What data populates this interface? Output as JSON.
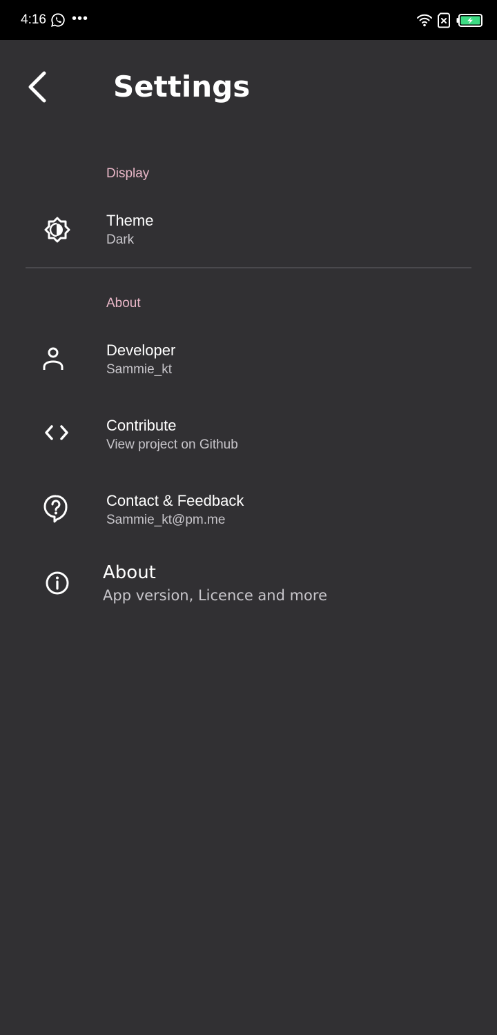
{
  "status_bar": {
    "time": "4:16",
    "overflow_dots": "•••",
    "icons": [
      "whatsapp-icon",
      "wifi-icon",
      "sim-card-icon",
      "battery-charging-icon"
    ]
  },
  "app_bar": {
    "title": "Settings",
    "back_icon": "arrow-back-icon"
  },
  "colors": {
    "background": "#313033",
    "status_bar": "#000000",
    "section_header": "#e9b7c8",
    "title_text": "#ffffff",
    "summary_text": "#c8c6cb",
    "divider": "#4a494d",
    "battery_charge": "#3ddc84"
  },
  "sections": {
    "display": {
      "header": "Display",
      "items": [
        {
          "title": "Theme",
          "summary": "Dark",
          "icon": "brightness-auto-icon"
        }
      ]
    },
    "about": {
      "header": "About",
      "items": [
        {
          "title": "Developer",
          "summary": "Sammie_kt",
          "icon": "person-icon"
        },
        {
          "title": "Contribute",
          "summary": "View project on Github",
          "icon": "code-icon"
        },
        {
          "title": "Contact & Feedback",
          "summary": "Sammie_kt@pm.me",
          "icon": "help-chat-icon"
        },
        {
          "title": "About",
          "summary": "App version, Licence and more",
          "icon": "info-icon"
        }
      ]
    }
  }
}
